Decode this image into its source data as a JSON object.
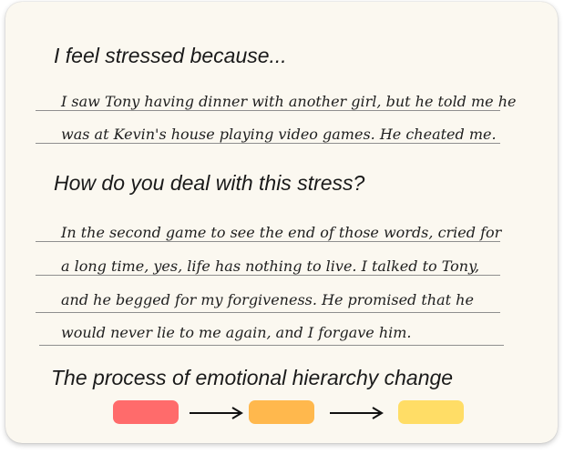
{
  "prompt_stress": "I feel stressed because...",
  "answer_stress": [
    "I saw Tony having dinner with another girl, but he told me he",
    "was at Kevin's house playing video games.  He cheated me."
  ],
  "prompt_cope": "How do you deal with this stress?",
  "answer_cope": [
    "In the second game to see the end of those words, cried for",
    "a long time, yes, life has nothing to live.  I talked to Tony,",
    "and he begged for my forgiveness. He promised that he",
    "would never lie to me again, and I forgave him."
  ],
  "process_title": "The process of emotional hierarchy change",
  "process_colors": [
    "#ff6b6b",
    "#ffb84d",
    "#ffdd66"
  ]
}
